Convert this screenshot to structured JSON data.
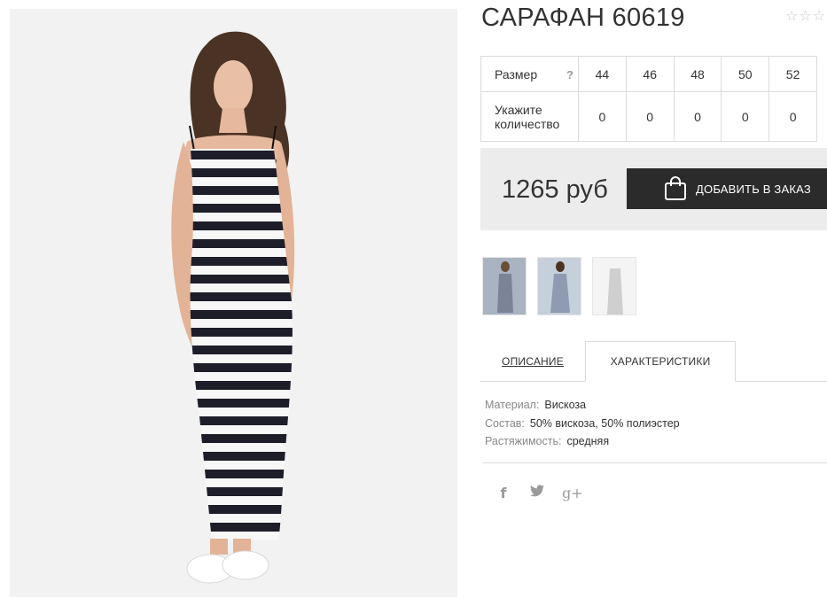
{
  "product": {
    "title": "САРАФАН 60619",
    "rating_stars": [
      "☆",
      "☆",
      "☆"
    ]
  },
  "size_table": {
    "size_label": "Размер",
    "help": "?",
    "sizes": [
      "44",
      "46",
      "48",
      "50",
      "52"
    ],
    "quantity_label_line1": "Укажите",
    "quantity_label_line2": "количество",
    "quantities": [
      "0",
      "0",
      "0",
      "0",
      "0"
    ]
  },
  "buy": {
    "price": "1265 руб",
    "add_button": "ДОБАВИТЬ В ЗАКАЗ"
  },
  "tabs": {
    "description": "ОПИСАНИЕ",
    "characteristics": "ХАРАКТЕРИСТИКИ",
    "active": "characteristics"
  },
  "characteristics": [
    {
      "key": "Материал:",
      "value": "Вискоза"
    },
    {
      "key": "Состав:",
      "value": "50% вискоза, 50% полиэстер"
    },
    {
      "key": "Растяжимость:",
      "value": "средняя"
    }
  ],
  "social": {
    "facebook": "f",
    "twitter": "🐦",
    "googleplus": "g+"
  },
  "colors": {
    "button_bg": "#2b2b2b",
    "buy_box_bg": "#ececec",
    "border": "#dcdcdc",
    "muted_text": "#888888"
  }
}
